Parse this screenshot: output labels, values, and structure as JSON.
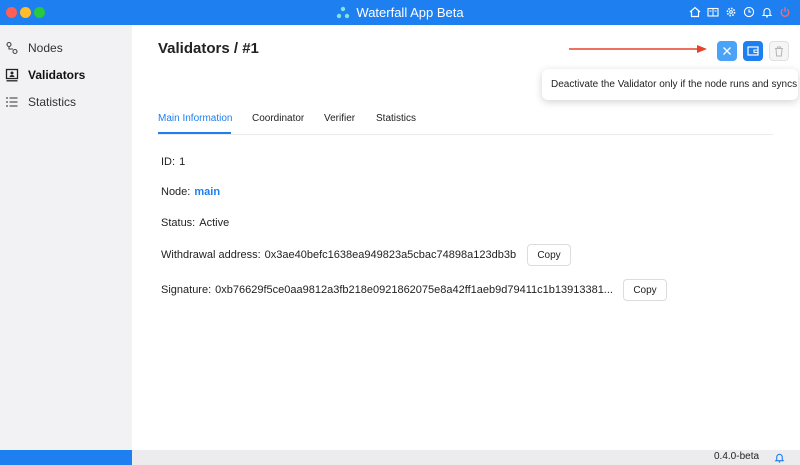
{
  "window": {
    "title": "Waterfall App Beta"
  },
  "titlebar_icons": [
    "home-icon",
    "book-icon",
    "gear-icon",
    "clock-icon",
    "bell-icon",
    "power-icon"
  ],
  "sidebar": {
    "items": [
      {
        "label": "Nodes",
        "icon": "nodes-icon"
      },
      {
        "label": "Validators",
        "icon": "validators-icon",
        "active": true
      },
      {
        "label": "Statistics",
        "icon": "list-icon"
      }
    ]
  },
  "header": {
    "title": "Validators",
    "separator": "/",
    "id": "#1"
  },
  "actions": {
    "close_icon": "close-icon",
    "wallet_icon": "wallet-icon",
    "delete_icon": "trash-icon"
  },
  "tooltip": {
    "text": "Deactivate the Validator only if the node runs and syncs"
  },
  "tabs": [
    {
      "label": "Main Information",
      "active": true
    },
    {
      "label": "Coordinator"
    },
    {
      "label": "Verifier"
    },
    {
      "label": "Statistics"
    }
  ],
  "details": {
    "id_label": "ID:",
    "id_value": "1",
    "node_label": "Node:",
    "node_value": "main",
    "status_label": "Status:",
    "status_value": "Active",
    "withdrawal_label": "Withdrawal address:",
    "withdrawal_value": "0x3ae40befc1638ea949823a5cbac74898a123db3b",
    "signature_label": "Signature:",
    "signature_value": "0xb76629f5ce0aa9812a3fb218e0921862075e8a42ff1aeb9d79411c1b13913381...",
    "copy_label": "Copy"
  },
  "statusbar": {
    "version": "0.4.0-beta"
  },
  "colors": {
    "accent": "#1d7ff0",
    "arrow": "#e8412c"
  }
}
